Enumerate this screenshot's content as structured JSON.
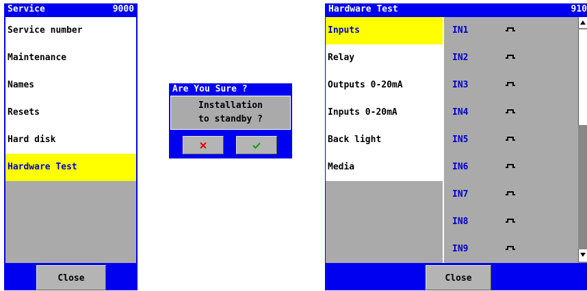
{
  "service": {
    "title": "Service",
    "code": "9000",
    "items": [
      {
        "label": "Service number"
      },
      {
        "label": "Maintenance"
      },
      {
        "label": "Names"
      },
      {
        "label": "Resets"
      },
      {
        "label": "Hard disk"
      },
      {
        "label": "Hardware Test",
        "selected": true
      }
    ],
    "close_label": "Close"
  },
  "dialog": {
    "title": "Are You Sure ?",
    "message_line1": "Installation",
    "message_line2": "to standby ?",
    "cancel_icon": "x-icon",
    "confirm_icon": "check-icon",
    "cancel_color": "#e00000",
    "confirm_color": "#00a000"
  },
  "hardware": {
    "title": "Hardware Test",
    "code": "910",
    "items": [
      {
        "label": "Inputs",
        "selected": true
      },
      {
        "label": "Relay"
      },
      {
        "label": "Outputs 0-20mA"
      },
      {
        "label": "Inputs 0-20mA"
      },
      {
        "label": "Back light"
      },
      {
        "label": "Media"
      }
    ],
    "inputs": [
      {
        "label": "IN1",
        "icon": "pulse-icon"
      },
      {
        "label": "IN2",
        "icon": "pulse-icon"
      },
      {
        "label": "IN3",
        "icon": "pulse-icon"
      },
      {
        "label": "IN4",
        "icon": "pulse-icon"
      },
      {
        "label": "IN5",
        "icon": "pulse-icon"
      },
      {
        "label": "IN6",
        "icon": "pulse-icon"
      },
      {
        "label": "IN7",
        "icon": "pulse-icon"
      },
      {
        "label": "IN8",
        "icon": "pulse-icon"
      },
      {
        "label": "IN9",
        "icon": "pulse-icon"
      }
    ],
    "close_label": "Close"
  },
  "colors": {
    "title_blue": "#0000f0",
    "selected_yellow": "#ffff00",
    "selected_text": "#0000c8",
    "panel_gray": "#aaaaaa"
  }
}
